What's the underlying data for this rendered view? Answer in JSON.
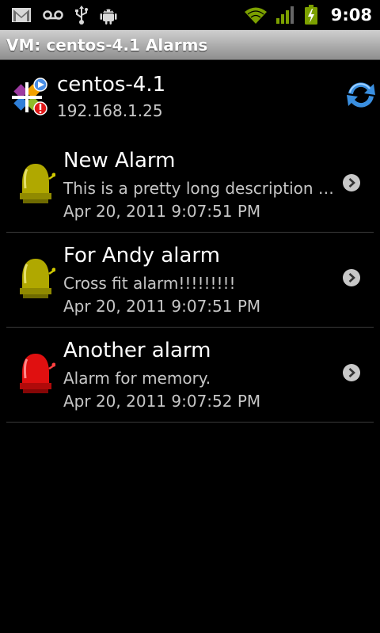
{
  "status_bar": {
    "time": "9:08",
    "left_icons": [
      "gmail-icon",
      "voicemail-icon",
      "usb-icon",
      "android-debug-icon"
    ],
    "right_icons": [
      "wifi-icon",
      "signal-icon",
      "battery-charging-icon"
    ]
  },
  "title_bar": {
    "title": "VM: centos-4.1 Alarms"
  },
  "vm": {
    "name": "centos-4.1",
    "ip": "192.168.1.25",
    "logo_icon": "centos-running-alert-icon",
    "refresh_icon": "refresh-icon"
  },
  "alarms": [
    {
      "title": "New Alarm",
      "description": "This is a pretty long description whi...",
      "date": "Apr 20, 2011 9:07:51 PM",
      "bell_color": "#b0a800",
      "status": "inactive"
    },
    {
      "title": "For Andy alarm",
      "description": "Cross fit alarm!!!!!!!!!",
      "date": "Apr 20, 2011 9:07:51 PM",
      "bell_color": "#b0a800",
      "status": "inactive"
    },
    {
      "title": "Another alarm",
      "description": "Alarm for memory.",
      "date": "Apr 20, 2011 9:07:52 PM",
      "bell_color": "#e01010",
      "status": "active"
    }
  ],
  "colors": {
    "background": "#000000",
    "inactive_bell": "#b0a800",
    "active_bell": "#e01010",
    "secondary_text": "#c6c6c6"
  }
}
